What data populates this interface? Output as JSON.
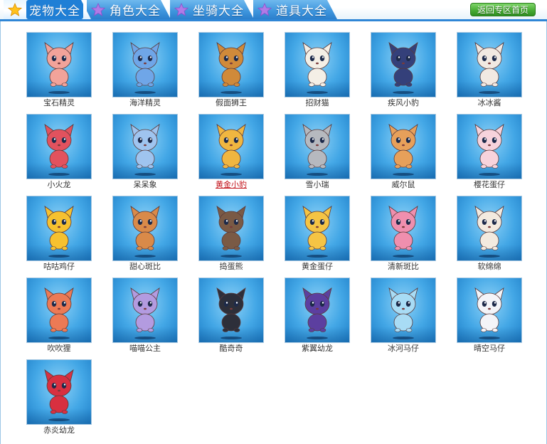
{
  "tabs": [
    {
      "label": "宠物大全",
      "active": true
    },
    {
      "label": "角色大全",
      "active": false
    },
    {
      "label": "坐骑大全",
      "active": false
    },
    {
      "label": "道具大全",
      "active": false
    }
  ],
  "back_button": "返回专区首页",
  "pets": [
    {
      "name": "宝石精灵",
      "icon": "fox-pet-icon",
      "color": "#f2a39a"
    },
    {
      "name": "海洋精灵",
      "icon": "blue-dragon-pet-icon",
      "color": "#6fa6e8"
    },
    {
      "name": "假面狮王",
      "icon": "lion-pet-icon",
      "color": "#d08a3a"
    },
    {
      "name": "招财猫",
      "icon": "lucky-cat-pet-icon",
      "color": "#f4efe6"
    },
    {
      "name": "疾风小豹",
      "icon": "black-panther-pet-icon",
      "color": "#34407a"
    },
    {
      "name": "冰冰酱",
      "icon": "white-fox-pet-icon",
      "color": "#f1e9e2"
    },
    {
      "name": "小火龙",
      "icon": "red-dragon-pet-icon",
      "color": "#e2525e"
    },
    {
      "name": "呆呆象",
      "icon": "elephant-pet-icon",
      "color": "#9fc4ef"
    },
    {
      "name": "黄金小豹",
      "icon": "leopard-pet-icon",
      "color": "#f0b640",
      "link": true
    },
    {
      "name": "雪小瑞",
      "icon": "schnauzer-pet-icon",
      "color": "#b6b9bf"
    },
    {
      "name": "威尔鼠",
      "icon": "hamster-pet-icon",
      "color": "#e7a05a"
    },
    {
      "name": "樱花蛋仔",
      "icon": "pink-egg-pet-icon",
      "color": "#f7d3dc"
    },
    {
      "name": "咕咕鸡仔",
      "icon": "chick-pet-icon",
      "color": "#f6c12f"
    },
    {
      "name": "甜心斑比",
      "icon": "deer-pet-icon",
      "color": "#d98a49"
    },
    {
      "name": "捣蛋熊",
      "icon": "raccoon-pet-icon",
      "color": "#7a5a45"
    },
    {
      "name": "黄金蛋仔",
      "icon": "golden-egg-pet-icon",
      "color": "#f5c444"
    },
    {
      "name": "清新斑比",
      "icon": "pink-deer-pet-icon",
      "color": "#ef8fae"
    },
    {
      "name": "软绵绵",
      "icon": "sheep-pet-icon",
      "color": "#f3eadf"
    },
    {
      "name": "吹吹狸",
      "icon": "red-fox-pet-icon",
      "color": "#ec7a55"
    },
    {
      "name": "喵喵公主",
      "icon": "purple-cat-pet-icon",
      "color": "#b39be0"
    },
    {
      "name": "酷奇奇",
      "icon": "husky-pet-icon",
      "color": "#2d2f3a"
    },
    {
      "name": "紫翼幼龙",
      "icon": "purple-dragon-pet-icon",
      "color": "#5c3fa0"
    },
    {
      "name": "冰河马仔",
      "icon": "ice-pony-pet-icon",
      "color": "#a8dcf5"
    },
    {
      "name": "晴空马仔",
      "icon": "white-pony-pet-icon",
      "color": "#f4f4f8"
    },
    {
      "name": "赤炎幼龙",
      "icon": "flame-dragon-pet-icon",
      "color": "#d83040"
    }
  ],
  "colors": {
    "tab_blue": "#2f86d6",
    "link_red": "#c2121a",
    "button_green": "#49ad35"
  }
}
